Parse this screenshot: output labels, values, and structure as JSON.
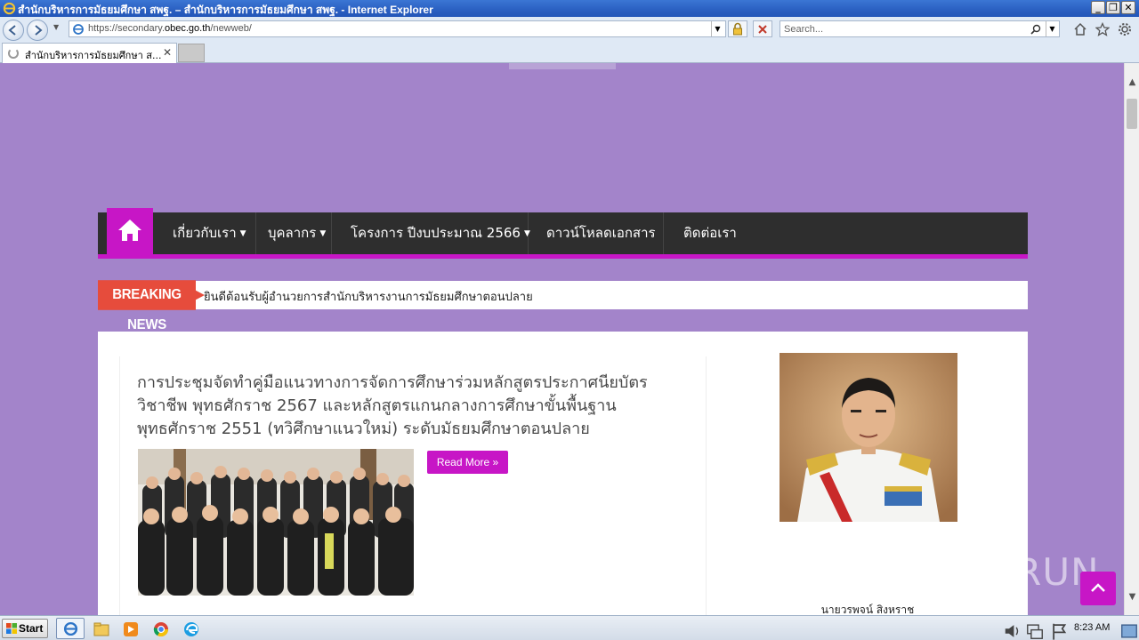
{
  "window": {
    "title": "สำนักบริหารการมัธยมศึกษา สพฐ. – สำนักบริหารการมัธยมศึกษา สพฐ. - Internet Explorer",
    "minimize": "_",
    "restore": "❐",
    "close": "✕"
  },
  "address_bar": {
    "url_prefix": "https://secondary.",
    "url_domain": "obec.go.th",
    "url_suffix": "/newweb/",
    "search_placeholder": "Search..."
  },
  "tabs": [
    {
      "label": "สำนักบริหารการมัธยมศึกษา ส...",
      "close": "✕"
    }
  ],
  "nav": {
    "items": [
      {
        "label": "เกี่ยวกับเรา",
        "has_dropdown": true
      },
      {
        "label": "บุคลากร",
        "has_dropdown": true
      },
      {
        "label": "โครงการ ปีงบประมาณ 2566",
        "has_dropdown": true
      },
      {
        "label": "ดาวน์โหลดเอกสาร",
        "has_dropdown": false
      },
      {
        "label": "ติดต่อเรา",
        "has_dropdown": false
      }
    ],
    "caret": "▼"
  },
  "breaking": {
    "tag": "BREAKING NEWS",
    "text": "ยินดีต้อนรับผู้อำนวยการสำนักบริหารงานการมัธยมศึกษาตอนปลาย"
  },
  "post": {
    "title": "การประชุมจัดทำคู่มือแนวทางการจัดการศึกษาร่วมหลักสูตรประกาศนียบัตรวิชาชีพ พุทธศักราช 2567 และหลักสูตรแกนกลางการศึกษาขั้นพื้นฐาน พุทธศักราช 2551 (ทวิศึกษาแนวใหม่) ระดับมัธยมศึกษาตอนปลาย",
    "read_more": "Read More »"
  },
  "sidebar": {
    "name": "นายวรพจน์ สิงหราช"
  },
  "watermark": "ANY RUN",
  "taskbar": {
    "start": "Start",
    "time": "8:23 AM"
  },
  "colors": {
    "page_bg": "#a384ca",
    "accent": "#c716c6",
    "navbar": "#2e2e2e",
    "breaking_tag": "#e64c3c"
  }
}
